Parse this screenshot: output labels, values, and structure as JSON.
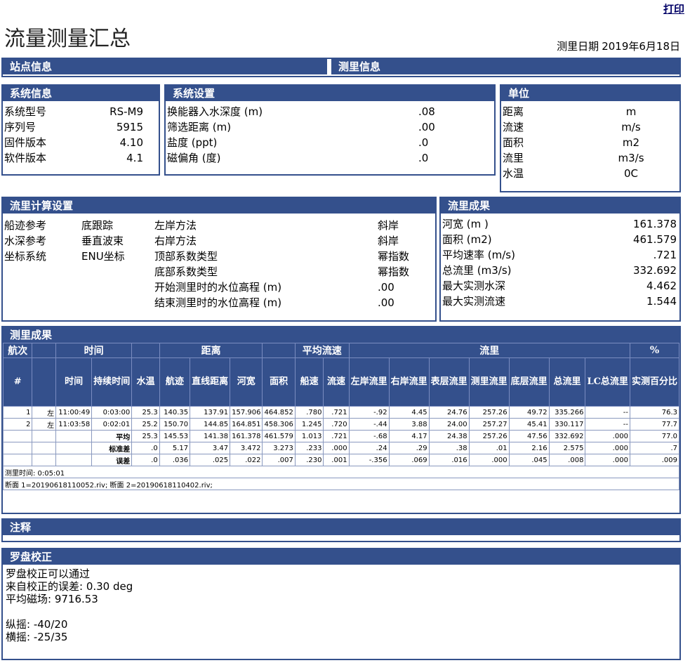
{
  "print_label": "打印",
  "title": "流量测量汇总",
  "measure_date_label": "测里日期",
  "measure_date": "2019年6月18日",
  "sections": {
    "site_info": "站点信息",
    "measure_info": "测里信息",
    "system_info": "系统信息",
    "system_settings": "系统设置",
    "units": "单位",
    "flow_calc": "流里计算设置",
    "flow_results": "流里成果",
    "measure_results": "测里成果",
    "notes": "注释",
    "compass": "罗盘校正"
  },
  "system_info": [
    {
      "label": "系统型号",
      "value": "RS-M9"
    },
    {
      "label": "序列号",
      "value": "5915"
    },
    {
      "label": "固件版本",
      "value": "4.10"
    },
    {
      "label": "软件版本",
      "value": "4.1"
    }
  ],
  "system_settings": [
    {
      "label": "换能器入水深度 (m)",
      "value": ".08"
    },
    {
      "label": "筛选距离 (m)",
      "value": ".00"
    },
    {
      "label": "盐度 (ppt)",
      "value": ".0"
    },
    {
      "label": "磁偏角 (度)",
      "value": ".0"
    }
  ],
  "units": [
    {
      "label": "距离",
      "value": "m"
    },
    {
      "label": "流速",
      "value": "m/s"
    },
    {
      "label": "面积",
      "value": "m2"
    },
    {
      "label": "流里",
      "value": "m3/s"
    },
    {
      "label": "水温",
      "value": "0C"
    }
  ],
  "flow_calc": {
    "left": [
      {
        "label": "船迹参考",
        "value": "底跟踪"
      },
      {
        "label": "水深参考",
        "value": "垂直波束"
      },
      {
        "label": "坐标系统",
        "value": "ENU坐标"
      }
    ],
    "right": [
      {
        "label": "左岸方法",
        "value": "斜岸"
      },
      {
        "label": "右岸方法",
        "value": "斜岸"
      },
      {
        "label": "顶部系数类型",
        "value": "幂指数"
      },
      {
        "label": "底部系数类型",
        "value": "幂指数"
      },
      {
        "label": "开始测里时的水位高程 (m)",
        "value": ".00"
      },
      {
        "label": "结束测里时的水位高程 (m)",
        "value": ".00"
      }
    ]
  },
  "flow_results": [
    {
      "label": "河宽 (m )",
      "value": "161.378"
    },
    {
      "label": "面积 (m2)",
      "value": "461.579"
    },
    {
      "label": "平均速率 (m/s)",
      "value": ".721"
    },
    {
      "label": "总流里 (m3/s)",
      "value": "332.692"
    },
    {
      "label": "最大实测水深",
      "value": "4.462"
    },
    {
      "label": "最大实测流速",
      "value": "1.544"
    }
  ],
  "table": {
    "group_headers": [
      "航次",
      "",
      "时间",
      "",
      "距离",
      "",
      "平均流速",
      "流里",
      "%"
    ],
    "headers": [
      "#",
      "",
      "时间",
      "持续时间",
      "水温",
      "航迹",
      "直线距离",
      "河宽",
      "面积",
      "船速",
      "流速",
      "左岸流里",
      "右岸流里",
      "表层流里",
      "测里流里",
      "底层流里",
      "总流里",
      "LC总流里",
      "实测百分比"
    ],
    "rows": [
      [
        "1",
        "左",
        "11:00:49",
        "0:03:00",
        "25.3",
        "140.35",
        "137.91",
        "157.906",
        "464.852",
        ".780",
        ".721",
        "-.92",
        "4.45",
        "24.76",
        "257.26",
        "49.72",
        "335.266",
        "--",
        "76.3"
      ],
      [
        "2",
        "左",
        "11:03:58",
        "0:02:01",
        "25.2",
        "150.70",
        "144.85",
        "164.851",
        "458.306",
        "1.245",
        ".720",
        "-.44",
        "3.88",
        "24.00",
        "257.27",
        "45.41",
        "330.117",
        "--",
        "77.7"
      ],
      [
        "",
        "",
        "",
        "平均",
        "25.3",
        "145.53",
        "141.38",
        "161.378",
        "461.579",
        "1.013",
        ".721",
        "-.68",
        "4.17",
        "24.38",
        "257.26",
        "47.56",
        "332.692",
        ".000",
        "77.0"
      ],
      [
        "",
        "",
        "",
        "标准差",
        ".0",
        "5.17",
        "3.47",
        "3.472",
        "3.273",
        ".233",
        ".000",
        ".24",
        ".29",
        ".38",
        ".01",
        "2.16",
        "2.575",
        ".000",
        ".7"
      ],
      [
        "",
        "",
        "",
        "误差",
        ".0",
        ".036",
        ".025",
        ".022",
        ".007",
        ".230",
        ".001",
        "-.356",
        ".069",
        ".016",
        ".000",
        ".045",
        ".008",
        ".000",
        ".009"
      ]
    ],
    "measure_time": "测里时间:  0:05:01",
    "files": "断面 1=20190618110052.riv; 断面 2=20190618110402.riv;"
  },
  "compass": [
    "罗盘校正可以通过",
    "来自校正的误差: 0.30 deg",
    "平均磁场: 9716.53",
    "",
    "纵摇: -40/20",
    "横摇: -25/35"
  ]
}
